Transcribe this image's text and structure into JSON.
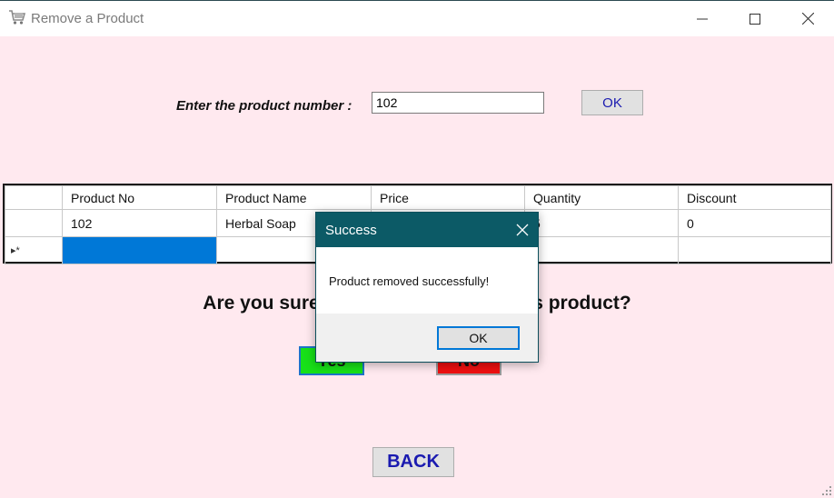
{
  "window": {
    "title": "Remove a Product",
    "icon": "shopping-cart-icon",
    "controls": [
      "minimize-icon",
      "maximize-icon",
      "close-icon"
    ]
  },
  "form": {
    "product_label": "Enter the product number :",
    "product_input_value": "102",
    "ok_label": "OK"
  },
  "grid": {
    "columns": [
      "Product No",
      "Product Name",
      "Price",
      "Quantity",
      "Discount"
    ],
    "rows": [
      [
        "102",
        "Herbal Soap",
        "",
        "5",
        "0"
      ]
    ],
    "new_row_marker": "▸*"
  },
  "question": "Are you sure you want to remove this product?",
  "buttons": {
    "yes": "Yes",
    "no": "No",
    "back": "BACK"
  },
  "dialog": {
    "title": "Success",
    "message": "Product removed successfully!",
    "ok_label": "OK"
  },
  "colors": {
    "form_background": "#ffe9ef",
    "dialog_titlebar": "#0c5a66",
    "yes_button": "#18e018",
    "no_button": "#ee1010",
    "selection": "#0078d7",
    "button_text_blue": "#1a1ab0"
  }
}
